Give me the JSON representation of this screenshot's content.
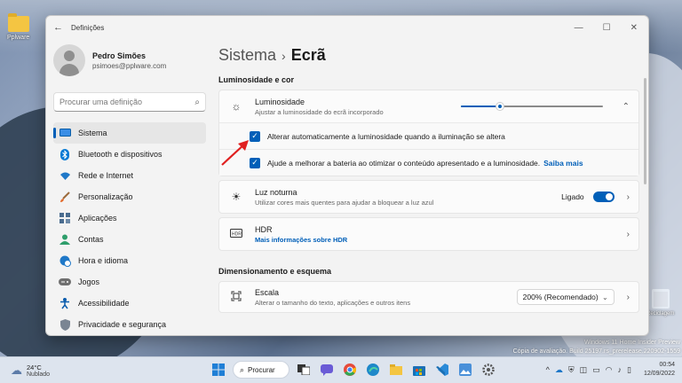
{
  "desktop": {
    "icons": [
      {
        "label": "Pplware"
      },
      {
        "label": "Reciclagem"
      }
    ],
    "watermark": {
      "line1": "Windows 11 Home Insider Preview",
      "line2": "Cópia de avaliação. Build 25197.rs_prerelease.220902-1559"
    }
  },
  "window": {
    "title": "Definições",
    "back_icon": "back-arrow-icon",
    "controls": {
      "minimize": "—",
      "maximize": "☐",
      "close": "✕"
    }
  },
  "profile": {
    "name": "Pedro Simões",
    "email": "psimoes@pplware.com"
  },
  "search": {
    "placeholder": "Procurar uma definição",
    "icon": "search-icon"
  },
  "nav": {
    "items": [
      {
        "label": "Sistema",
        "icon": "monitor-icon",
        "color": "#0078d4",
        "active": true
      },
      {
        "label": "Bluetooth e dispositivos",
        "icon": "bluetooth-icon",
        "color": "#0078d4"
      },
      {
        "label": "Rede e Internet",
        "icon": "wifi-icon",
        "color": "#0a5ea8"
      },
      {
        "label": "Personalização",
        "icon": "brush-icon",
        "color": "#e36b2c"
      },
      {
        "label": "Aplicações",
        "icon": "apps-icon",
        "color": "#4a6c8f"
      },
      {
        "label": "Contas",
        "icon": "person-icon",
        "color": "#2e9e6b"
      },
      {
        "label": "Hora e idioma",
        "icon": "globe-clock-icon",
        "color": "#1f78c8"
      },
      {
        "label": "Jogos",
        "icon": "gamepad-icon",
        "color": "#707070"
      },
      {
        "label": "Acessibilidade",
        "icon": "accessibility-icon",
        "color": "#0b5cad"
      },
      {
        "label": "Privacidade e segurança",
        "icon": "shield-icon",
        "color": "#7a8593"
      }
    ]
  },
  "page": {
    "breadcrumb_parent": "Sistema",
    "breadcrumb_separator": "›",
    "breadcrumb_current": "Ecrã"
  },
  "sections": {
    "brightness_color": "Luminosidade e cor",
    "scale_layout": "Dimensionamento e esquema"
  },
  "brightness": {
    "title": "Luminosidade",
    "subtitle": "Ajustar a luminosidade do ecrã incorporado",
    "value_percent": 28,
    "expand_icon": "chevron-up-icon",
    "auto_label": "Alterar automaticamente a luminosidade quando a iluminação se altera",
    "battery_label": "Ajude a melhorar a bateria ao otimizar o conteúdo apresentado e a luminosidade.",
    "learn_more": "Saiba mais"
  },
  "night_light": {
    "title": "Luz noturna",
    "subtitle": "Utilizar cores mais quentes para ajudar a bloquear a luz azul",
    "state": "Ligado"
  },
  "hdr": {
    "title": "HDR",
    "link": "Mais informações sobre HDR"
  },
  "scale": {
    "title": "Escala",
    "subtitle": "Alterar o tamanho do texto, aplicações e outros itens",
    "value": "200% (Recomendado)"
  },
  "taskbar": {
    "weather_temp": "24°C",
    "weather_cond": "Nublado",
    "search_label": "Procurar",
    "time": "00:54",
    "date": "12/09/2022"
  },
  "colors": {
    "accent": "#005fb8",
    "annotation_arrow": "#e02020"
  }
}
